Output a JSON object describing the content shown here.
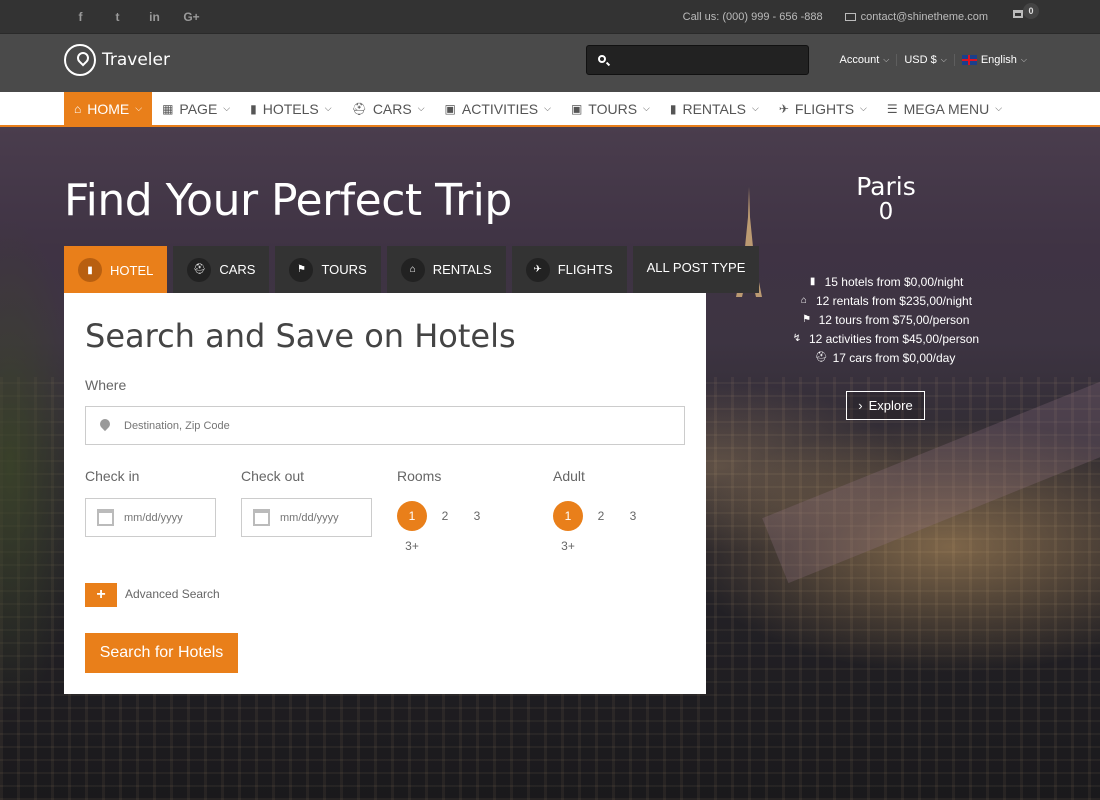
{
  "topbar": {
    "social": [
      {
        "icon": "facebook-icon",
        "glyph": "f"
      },
      {
        "icon": "twitter-icon",
        "glyph": "t"
      },
      {
        "icon": "linkedin-icon",
        "glyph": "in"
      },
      {
        "icon": "google-plus-icon",
        "glyph": "G+"
      }
    ],
    "phone": "Call us: (000) 999 - 656 -888",
    "email": "contact@shinetheme.com",
    "cart_count": "0"
  },
  "header": {
    "logo_text": "Traveler",
    "search_placeholder": "",
    "account_label": "Account",
    "currency_label": "USD $",
    "language_label": "English"
  },
  "nav": {
    "items": [
      {
        "label": "HOME",
        "icon": "home-icon",
        "active": true
      },
      {
        "label": "PAGE",
        "icon": "book-icon",
        "active": false
      },
      {
        "label": "HOTELS",
        "icon": "building-icon",
        "active": false
      },
      {
        "label": "CARS",
        "icon": "car-icon",
        "active": false
      },
      {
        "label": "ACTIVITIES",
        "icon": "binoculars-icon",
        "active": false
      },
      {
        "label": "TOURS",
        "icon": "binoculars-icon",
        "active": false
      },
      {
        "label": "RENTALS",
        "icon": "building-icon",
        "active": false
      },
      {
        "label": "FLIGHTS",
        "icon": "plane-icon",
        "active": false
      },
      {
        "label": "MEGA MENU",
        "icon": "list-icon",
        "active": false
      }
    ]
  },
  "hero": {
    "title": "Find Your Perfect Trip",
    "tabs": [
      {
        "label": "HOTEL",
        "icon": "building-icon",
        "active": true
      },
      {
        "label": "CARS",
        "icon": "car-icon",
        "active": false
      },
      {
        "label": "TOURS",
        "icon": "flag-icon",
        "active": false
      },
      {
        "label": "RENTALS",
        "icon": "home-icon",
        "active": false
      },
      {
        "label": "FLIGHTS",
        "icon": "plane-icon",
        "active": false
      },
      {
        "label": "ALL POST TYPE",
        "icon": "",
        "active": false
      }
    ]
  },
  "search": {
    "heading": "Search and Save on Hotels",
    "where_label": "Where",
    "where_placeholder": "Destination, Zip Code",
    "checkin_label": "Check in",
    "checkin_placeholder": "mm/dd/yyyy",
    "checkout_label": "Check out",
    "checkout_placeholder": "mm/dd/yyyy",
    "rooms_label": "Rooms",
    "rooms_options": [
      "1",
      "2",
      "3",
      "3+"
    ],
    "rooms_selected": "1",
    "adult_label": "Adult",
    "adult_options": [
      "1",
      "2",
      "3",
      "3+"
    ],
    "adult_selected": "1",
    "advanced_label": "Advanced Search",
    "submit_label": "Search for Hotels"
  },
  "destination": {
    "city": "Paris",
    "count": "0",
    "stats": [
      {
        "icon": "building-icon",
        "text": "15 hotels from $0,00/night"
      },
      {
        "icon": "home-icon",
        "text": "12 rentals from $235,00/night"
      },
      {
        "icon": "flag-icon",
        "text": "12 tours from $75,00/person"
      },
      {
        "icon": "bolt-icon",
        "text": "12 activities from $45,00/person"
      },
      {
        "icon": "car-icon",
        "text": "17 cars from $0,00/day"
      }
    ],
    "explore_label": "Explore"
  },
  "colors": {
    "accent": "#e97f1a",
    "topbar": "#333333",
    "header": "#4a4a4a",
    "tab_bg": "#333333"
  }
}
